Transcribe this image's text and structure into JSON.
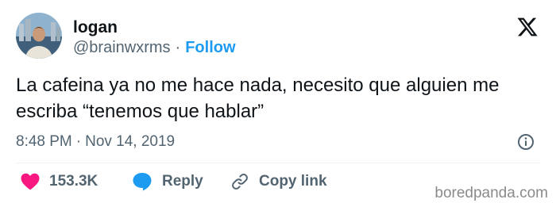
{
  "author": {
    "display_name": "logan",
    "handle": "@brainwxrms",
    "separator": "·",
    "follow_label": "Follow"
  },
  "tweet": {
    "text": "La cafeina ya no me hace nada, necesito que alguien me escriba “tenemos que hablar”",
    "time": "8:48 PM",
    "separator": "·",
    "date": "Nov 14, 2019"
  },
  "actions": {
    "likes": "153.3K",
    "reply_label": "Reply",
    "copy_link_label": "Copy link"
  },
  "watermark": "boredpanda.com",
  "icons": {
    "brand": "x-logo-icon",
    "info": "info-icon",
    "like": "heart-icon",
    "reply": "reply-bubble-icon",
    "copy": "link-icon"
  },
  "colors": {
    "text": "#0f1419",
    "secondary": "#536471",
    "follow": "#1d9bf0",
    "heart": "#f91880",
    "reply_bubble": "#1d9bf0"
  }
}
